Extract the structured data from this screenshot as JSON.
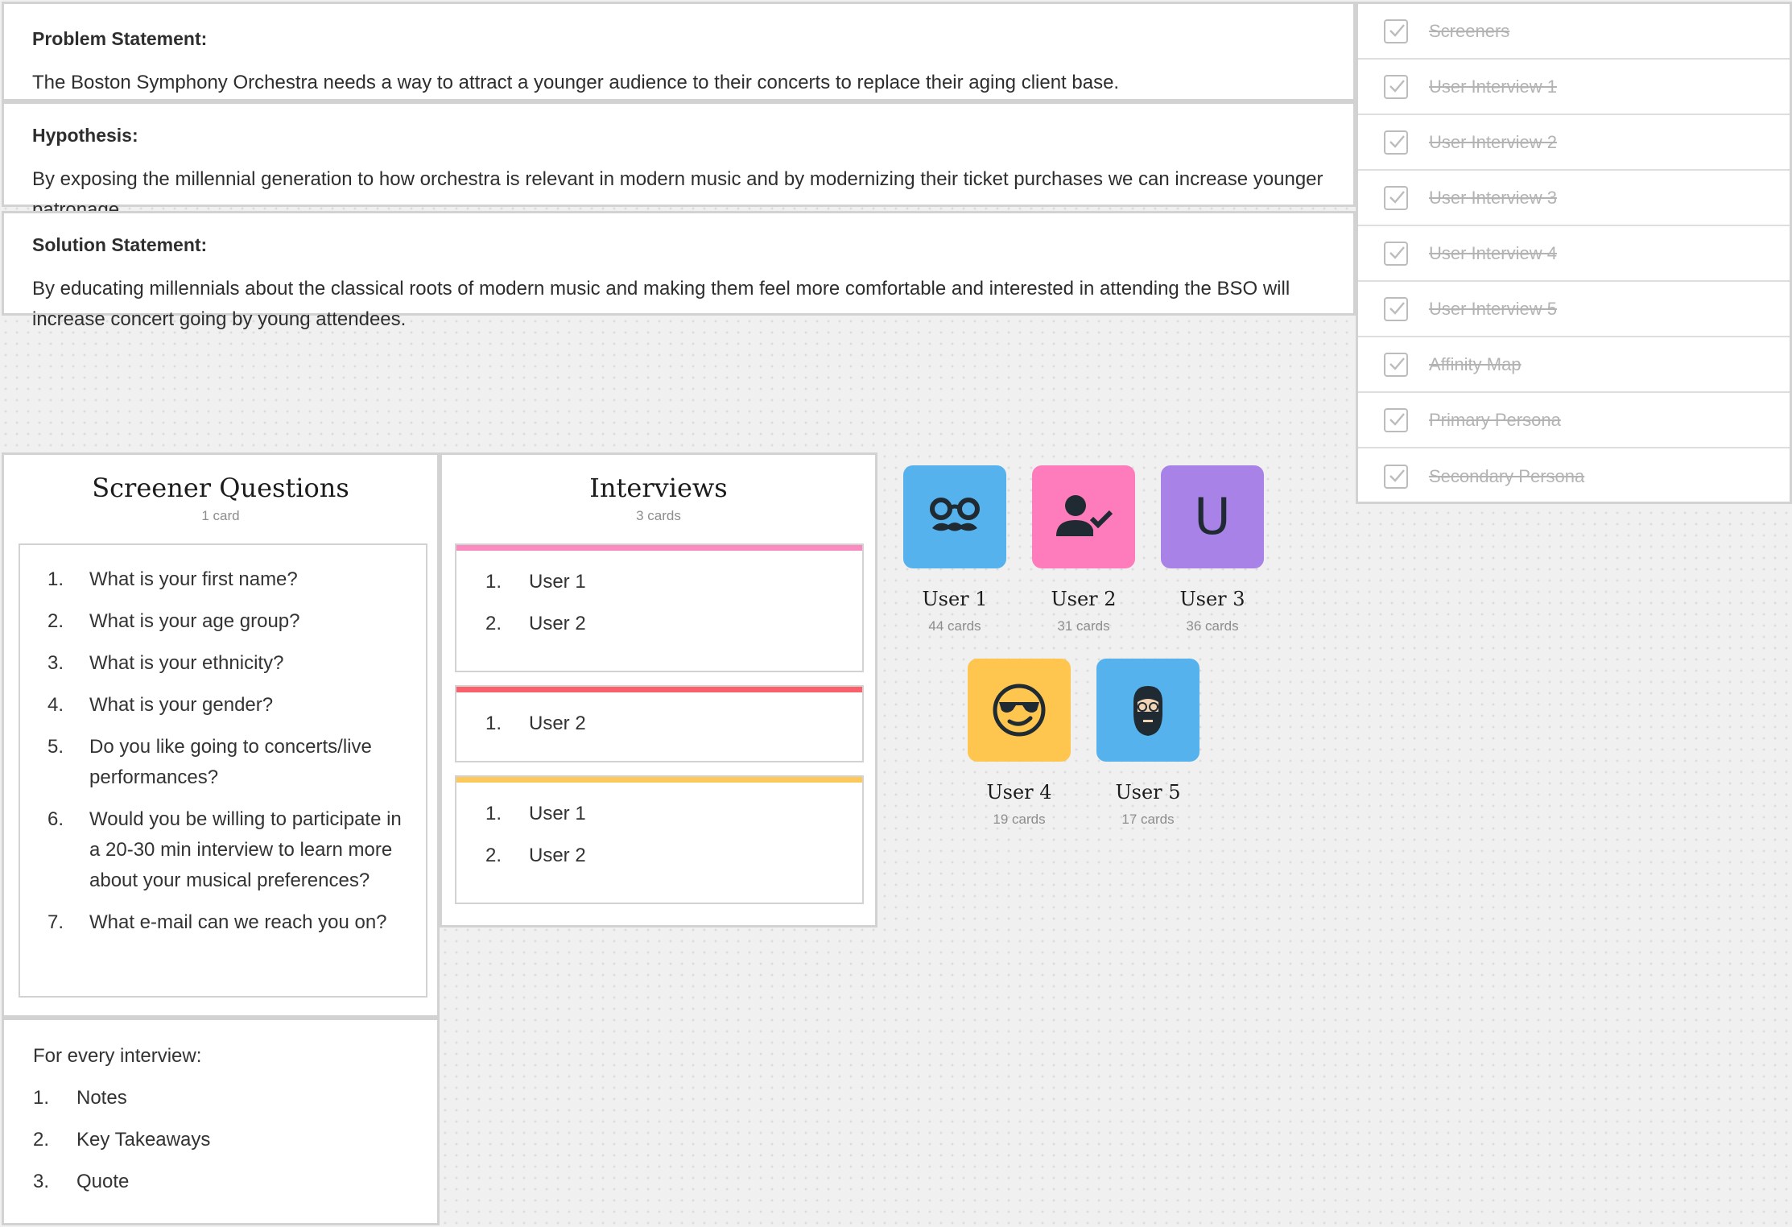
{
  "statements": [
    {
      "label": "Problem Statement:",
      "body": "The Boston Symphony Orchestra needs a way to attract a younger audience to their concerts to replace their aging client base."
    },
    {
      "label": "Hypothesis:",
      "body": "By exposing the millennial generation to how orchestra is relevant in modern music  and by modernizing their ticket purchases we can increase younger patronage."
    },
    {
      "label": "Solution Statement:",
      "body": "By educating millennials about the classical roots of modern music and making them feel more comfortable  and interested in attending the BSO will increase concert going by young attendees."
    }
  ],
  "checklist": [
    {
      "label": "Screeners",
      "checked": true
    },
    {
      "label": "User Interview 1",
      "checked": true
    },
    {
      "label": "User Interview 2",
      "checked": true
    },
    {
      "label": "User Interview 3",
      "checked": true
    },
    {
      "label": "User Interview 4",
      "checked": true
    },
    {
      "label": "User Interview 5",
      "checked": true
    },
    {
      "label": "Affinity Map",
      "checked": true
    },
    {
      "label": "Primary Persona",
      "checked": true
    },
    {
      "label": "Secondary Persona",
      "checked": true
    }
  ],
  "screener": {
    "title": "Screener Questions",
    "count": "1 card",
    "questions": [
      {
        "num": "1.",
        "text": "What is your first name?"
      },
      {
        "num": "2.",
        "text": "What is your age group?"
      },
      {
        "num": "3.",
        "text": "What is your ethnicity?"
      },
      {
        "num": "4.",
        "text": "What is your gender?"
      },
      {
        "num": "5.",
        "text": "Do you like going to concerts/live performances?"
      },
      {
        "num": "6.",
        "text": "Would you be willing to participate in a 20-30 min interview to learn more about your musical preferences?"
      },
      {
        "num": "7.",
        "text": "What e-mail can we reach you on?"
      }
    ]
  },
  "every_interview": {
    "heading": "For every interview:",
    "items": [
      {
        "num": "1.",
        "text": "Notes"
      },
      {
        "num": "2.",
        "text": "Key Takeaways"
      },
      {
        "num": "3.",
        "text": "Quote"
      }
    ]
  },
  "interviews": {
    "title": "Interviews",
    "count": "3 cards",
    "cards": [
      {
        "color": "#f98bc0",
        "items": [
          {
            "num": "1.",
            "text": "User 1"
          },
          {
            "num": "2.",
            "text": "User 2"
          }
        ]
      },
      {
        "color": "#f9606a",
        "items": [
          {
            "num": "1.",
            "text": "User 2"
          }
        ]
      },
      {
        "color": "#fcc85a",
        "items": [
          {
            "num": "1.",
            "text": "User 1"
          },
          {
            "num": "2.",
            "text": "User 2"
          }
        ]
      }
    ]
  },
  "users": [
    {
      "name": "User 1",
      "count": "44 cards",
      "color": "#55b2ec",
      "icon": "glasses-mustache-icon"
    },
    {
      "name": "User 2",
      "count": "31 cards",
      "color": "#fe7cbc",
      "icon": "user-check-icon"
    },
    {
      "name": "User 3",
      "count": "36 cards",
      "color": "#a882e6",
      "icon": "letter-u-icon",
      "letter": "U"
    },
    {
      "name": "User 4",
      "count": "19 cards",
      "color": "#fec54f",
      "icon": "sunglasses-smiley-icon"
    },
    {
      "name": "User 5",
      "count": "17 cards",
      "color": "#55b2ec",
      "icon": "bearded-man-icon"
    }
  ]
}
